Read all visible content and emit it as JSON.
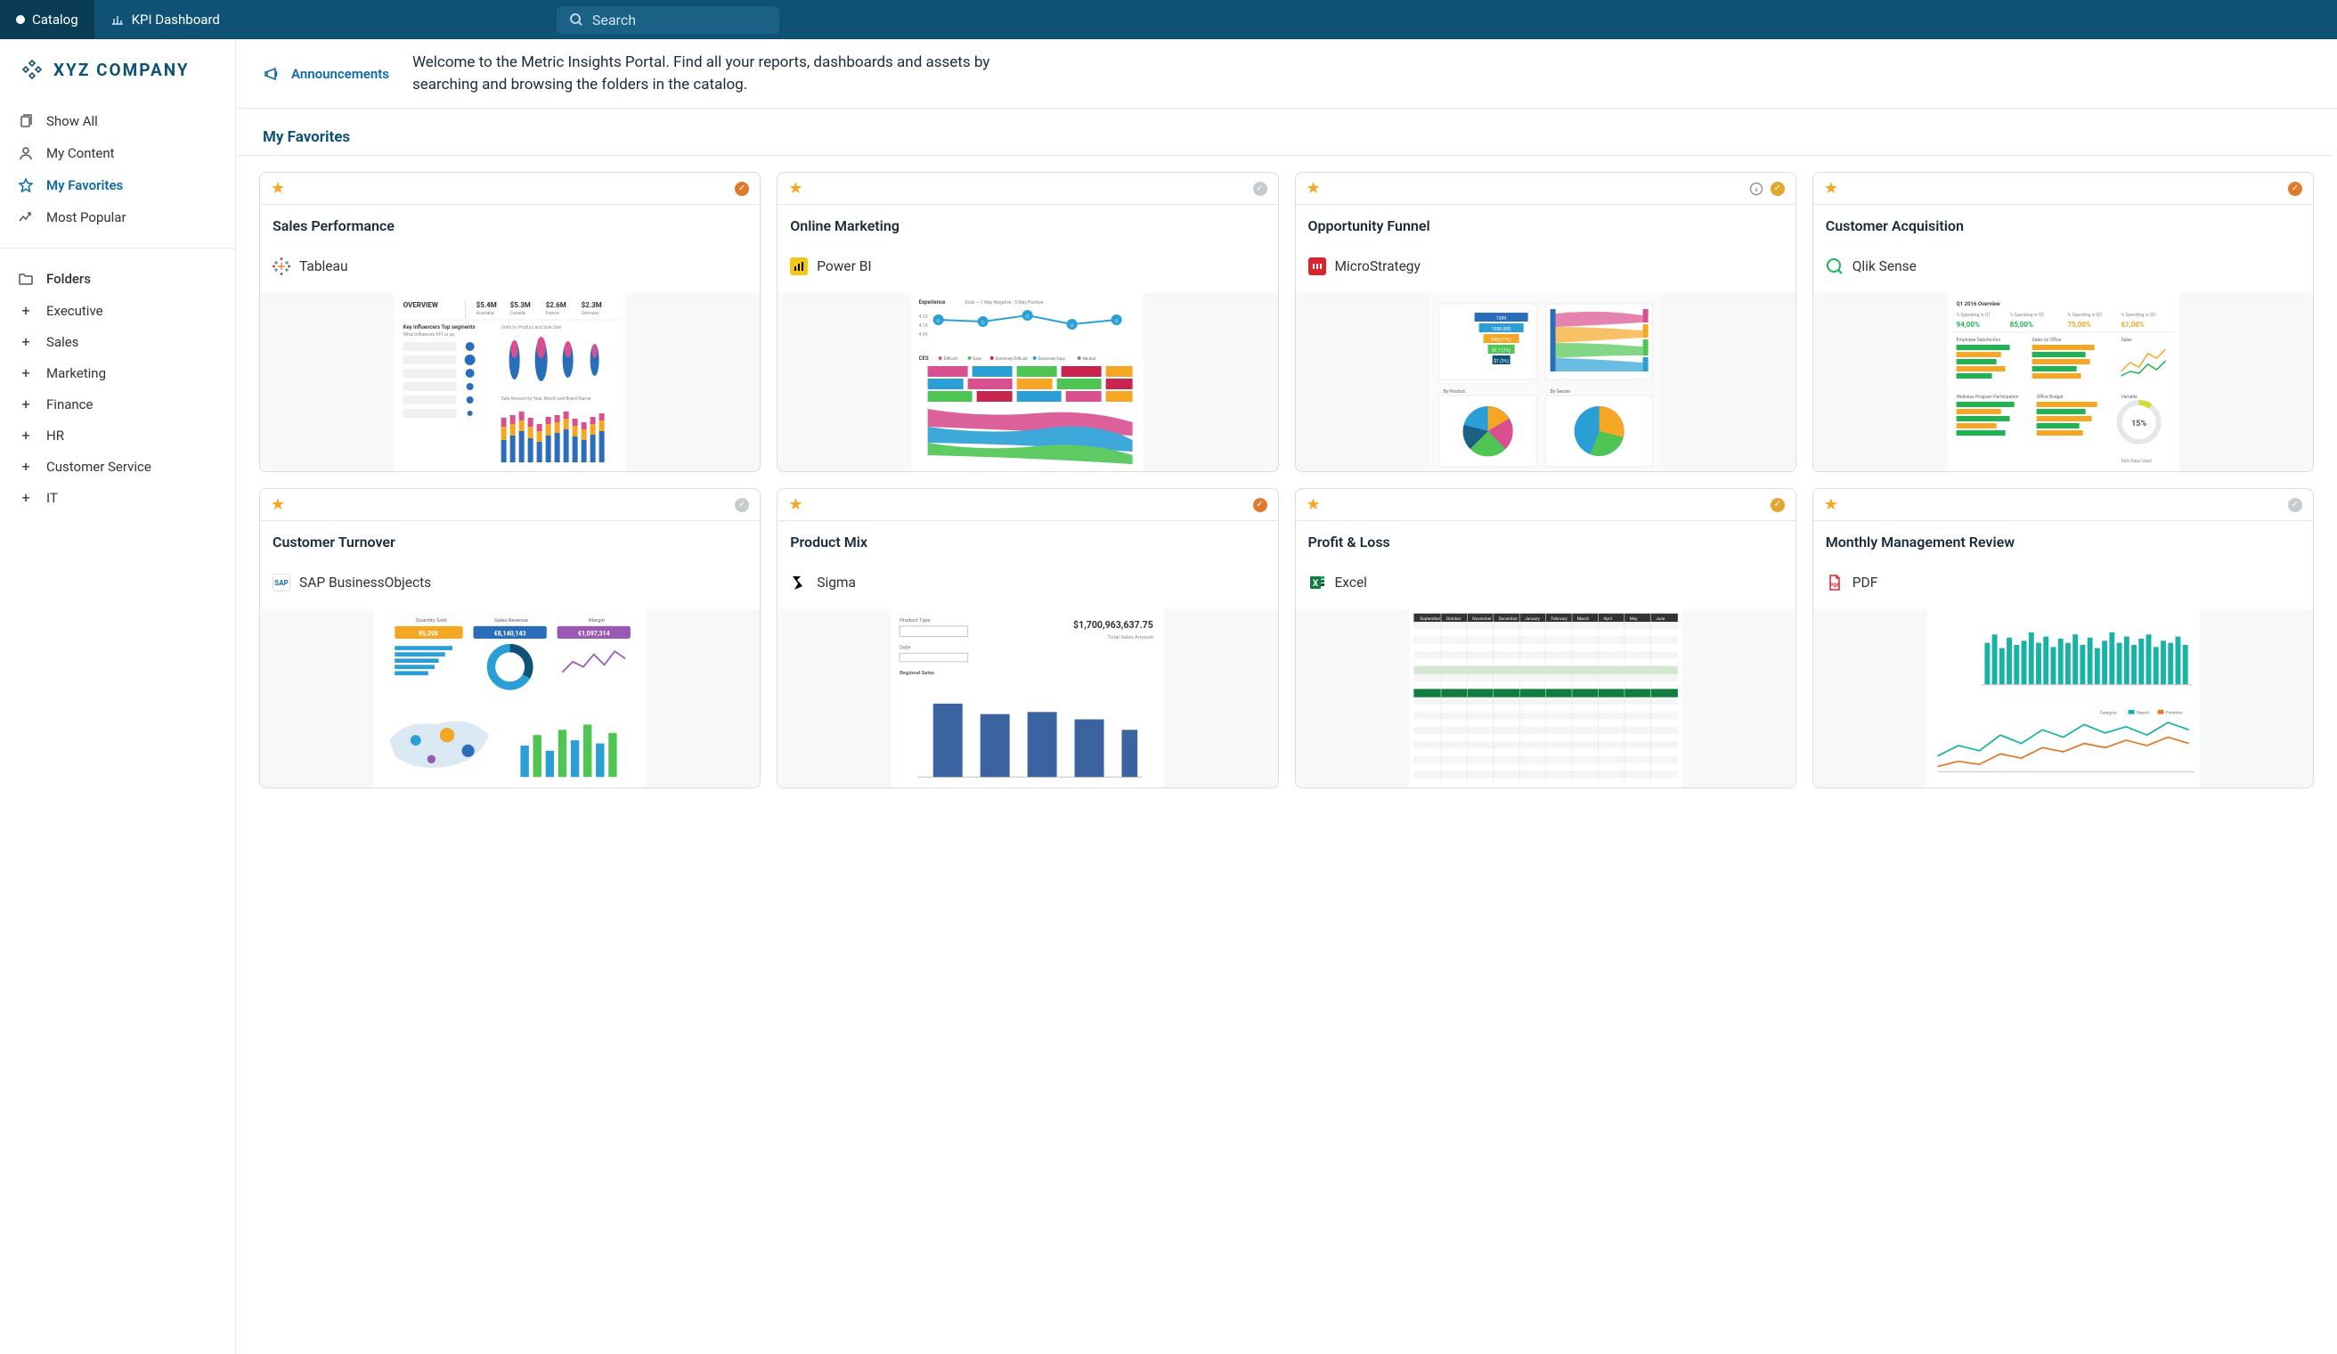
{
  "topbar": {
    "tabs": [
      {
        "label": "Catalog"
      },
      {
        "label": "KPI Dashboard"
      }
    ],
    "search_placeholder": "Search"
  },
  "company": {
    "name": "XYZ COMPANY"
  },
  "sidebar": {
    "items": [
      {
        "label": "Show All"
      },
      {
        "label": "My Content"
      },
      {
        "label": "My Favorites"
      },
      {
        "label": "Most Popular"
      }
    ],
    "folders_header": "Folders",
    "folders": [
      {
        "label": "Executive"
      },
      {
        "label": "Sales"
      },
      {
        "label": "Marketing"
      },
      {
        "label": "Finance"
      },
      {
        "label": "HR"
      },
      {
        "label": "Customer Service"
      },
      {
        "label": "IT"
      }
    ]
  },
  "announcements": {
    "label": "Announcements",
    "text": "Welcome to the Metric Insights Portal. Find all your reports, dashboards and assets by searching and browsing the folders in the catalog."
  },
  "section": {
    "title": "My Favorites"
  },
  "cards": [
    {
      "title": "Sales Performance",
      "source": "Tableau",
      "verify": "orange",
      "info": false
    },
    {
      "title": "Online Marketing",
      "source": "Power BI",
      "verify": "grey",
      "info": false
    },
    {
      "title": "Opportunity Funnel",
      "source": "MicroStrategy",
      "verify": "gold",
      "info": true
    },
    {
      "title": "Customer Acquisition",
      "source": "Qlik Sense",
      "verify": "orange",
      "info": false
    },
    {
      "title": "Customer Turnover",
      "source": "SAP BusinessObjects",
      "verify": "grey",
      "info": false
    },
    {
      "title": "Product Mix",
      "source": "Sigma",
      "verify": "orange",
      "info": false
    },
    {
      "title": "Profit & Loss",
      "source": "Excel",
      "verify": "gold",
      "info": false
    },
    {
      "title": "Monthly Management Review",
      "source": "PDF",
      "verify": "grey",
      "info": false
    }
  ],
  "thumbs": {
    "tableau": {
      "overview": "OVERVIEW",
      "kpis": [
        "$5.4M",
        "$5.3M",
        "$2.6M",
        "$2.3M"
      ],
      "kpi_labels": [
        "Australia",
        "Canada",
        "France",
        "Germany"
      ],
      "left_title": "Key influencers    Top segments",
      "left_sub": "What influences KPI vs up",
      "right_title": "Units by Product and Sale Size",
      "bottom_title": "Sale Amount by Year, Month and Brand Name"
    },
    "powerbi": {
      "experience": "Experience",
      "range": "Ends — 1 May Negative - 5 May Positive",
      "scale": [
        "4.23",
        "4.15",
        "4.09"
      ],
      "ces": "CES",
      "legend": [
        "Difficult",
        "Easy",
        "Extremely Difficult",
        "Extremely Easy",
        "Neutral"
      ]
    },
    "microstrategy": {
      "labels": [
        "By Product",
        "By Gender"
      ]
    },
    "qliksense": {
      "header": "Q1 2016 Overview",
      "cols": [
        "% Spending in Q1",
        "% Spending in Q2",
        "% Spending in Q3",
        "% Spending in Q3"
      ],
      "vals": [
        "94,00%",
        "85,00%",
        "75,00%",
        "61,00%"
      ],
      "charts": [
        "Employee Satisfaction",
        "Sales by Office",
        "Sales",
        "Wellness Program Participation",
        "Office Budget",
        "Variable"
      ],
      "gauge": "15%",
      "footer": "Sick Days Used"
    },
    "sap": {
      "labels": [
        "Quantity Sold",
        "Sales Revenue",
        "Margin"
      ],
      "vals": [
        "95,298",
        "€8,140,143",
        "€1,097,314"
      ]
    },
    "sigma": {
      "product_type": "Product Type",
      "date": "Date",
      "regional": "Regional Sales",
      "total": "$1,700,963,637.75",
      "total_label": "Total Sales Amount"
    },
    "excel": {
      "months": [
        "September",
        "October",
        "November",
        "December",
        "January",
        "February",
        "March",
        "April",
        "May",
        "June"
      ]
    },
    "pdf": {
      "labels": [
        "Category",
        "Report",
        "Furniture"
      ]
    }
  }
}
